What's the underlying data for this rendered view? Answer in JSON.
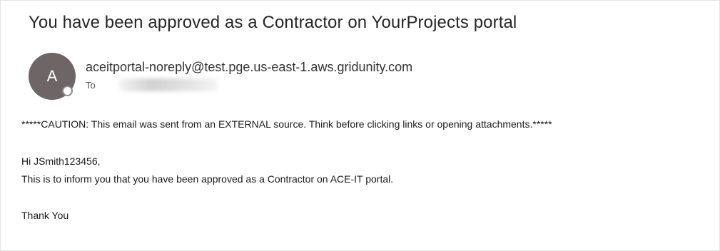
{
  "email": {
    "subject": "You have been approved as a Contractor on YourProjects portal",
    "sender": {
      "avatar_initial": "A",
      "address": "aceitportal-noreply@test.pge.us-east-1.aws.gridunity.com",
      "to_label": "To"
    },
    "body": {
      "caution": "*****CAUTION: This email was sent from an EXTERNAL source. Think before clicking links or opening attachments.*****",
      "greeting": "Hi JSmith123456,",
      "message": "This is to inform you that you have been approved as a Contractor on ACE-IT portal.",
      "closing": "Thank You"
    }
  },
  "colors": {
    "avatar_bg": "#6e6566",
    "text": "#1a1a1a",
    "background": "#ffffff"
  },
  "icons": {
    "presence": "presence-status-icon"
  }
}
